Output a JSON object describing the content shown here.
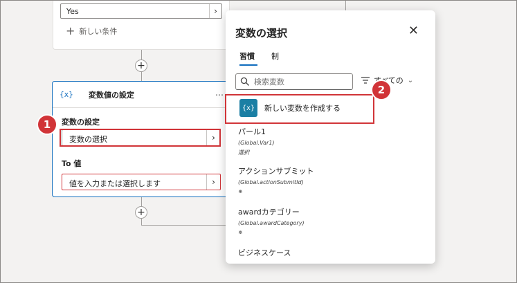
{
  "condition_card": {
    "yes_value": "Yes",
    "new_condition_label": "新しい条件"
  },
  "set_variable_card": {
    "title": "変数値の設定",
    "icon_text": "{x}",
    "more_label": "⋯",
    "variable_label": "変数の設定",
    "variable_value": "変数の選択",
    "to_label": "To 値",
    "to_placeholder": "値を入力または選択します"
  },
  "annotations": {
    "badge1": "1",
    "badge2": "2",
    "highlight_color": "#d13438"
  },
  "variable_picker": {
    "title": "変数の選択",
    "close_label": "✕",
    "tabs": [
      {
        "label": "習慣",
        "active": true
      },
      {
        "label": "制",
        "active": false
      }
    ],
    "search_placeholder": "検索変数",
    "filter_label": "すべての",
    "create_icon_text": "{x}",
    "create_label": "新しい変数を作成する",
    "variables": [
      {
        "name": "パール1",
        "scope": "(Global.Var1)",
        "type": "選択"
      },
      {
        "name": "アクションサブミット",
        "scope": "(Global.actionSubmitId)",
        "type": "※"
      },
      {
        "name": "awardカテゴリー",
        "scope": "(Global.awardCategory)",
        "type": "※"
      },
      {
        "name": "ビジネスケース",
        "scope": "",
        "type": ""
      }
    ]
  },
  "colors": {
    "accent": "#0f6cbd",
    "create_icon_bg": "#1b7fa4",
    "canvas_bg": "#f3f2f1"
  }
}
